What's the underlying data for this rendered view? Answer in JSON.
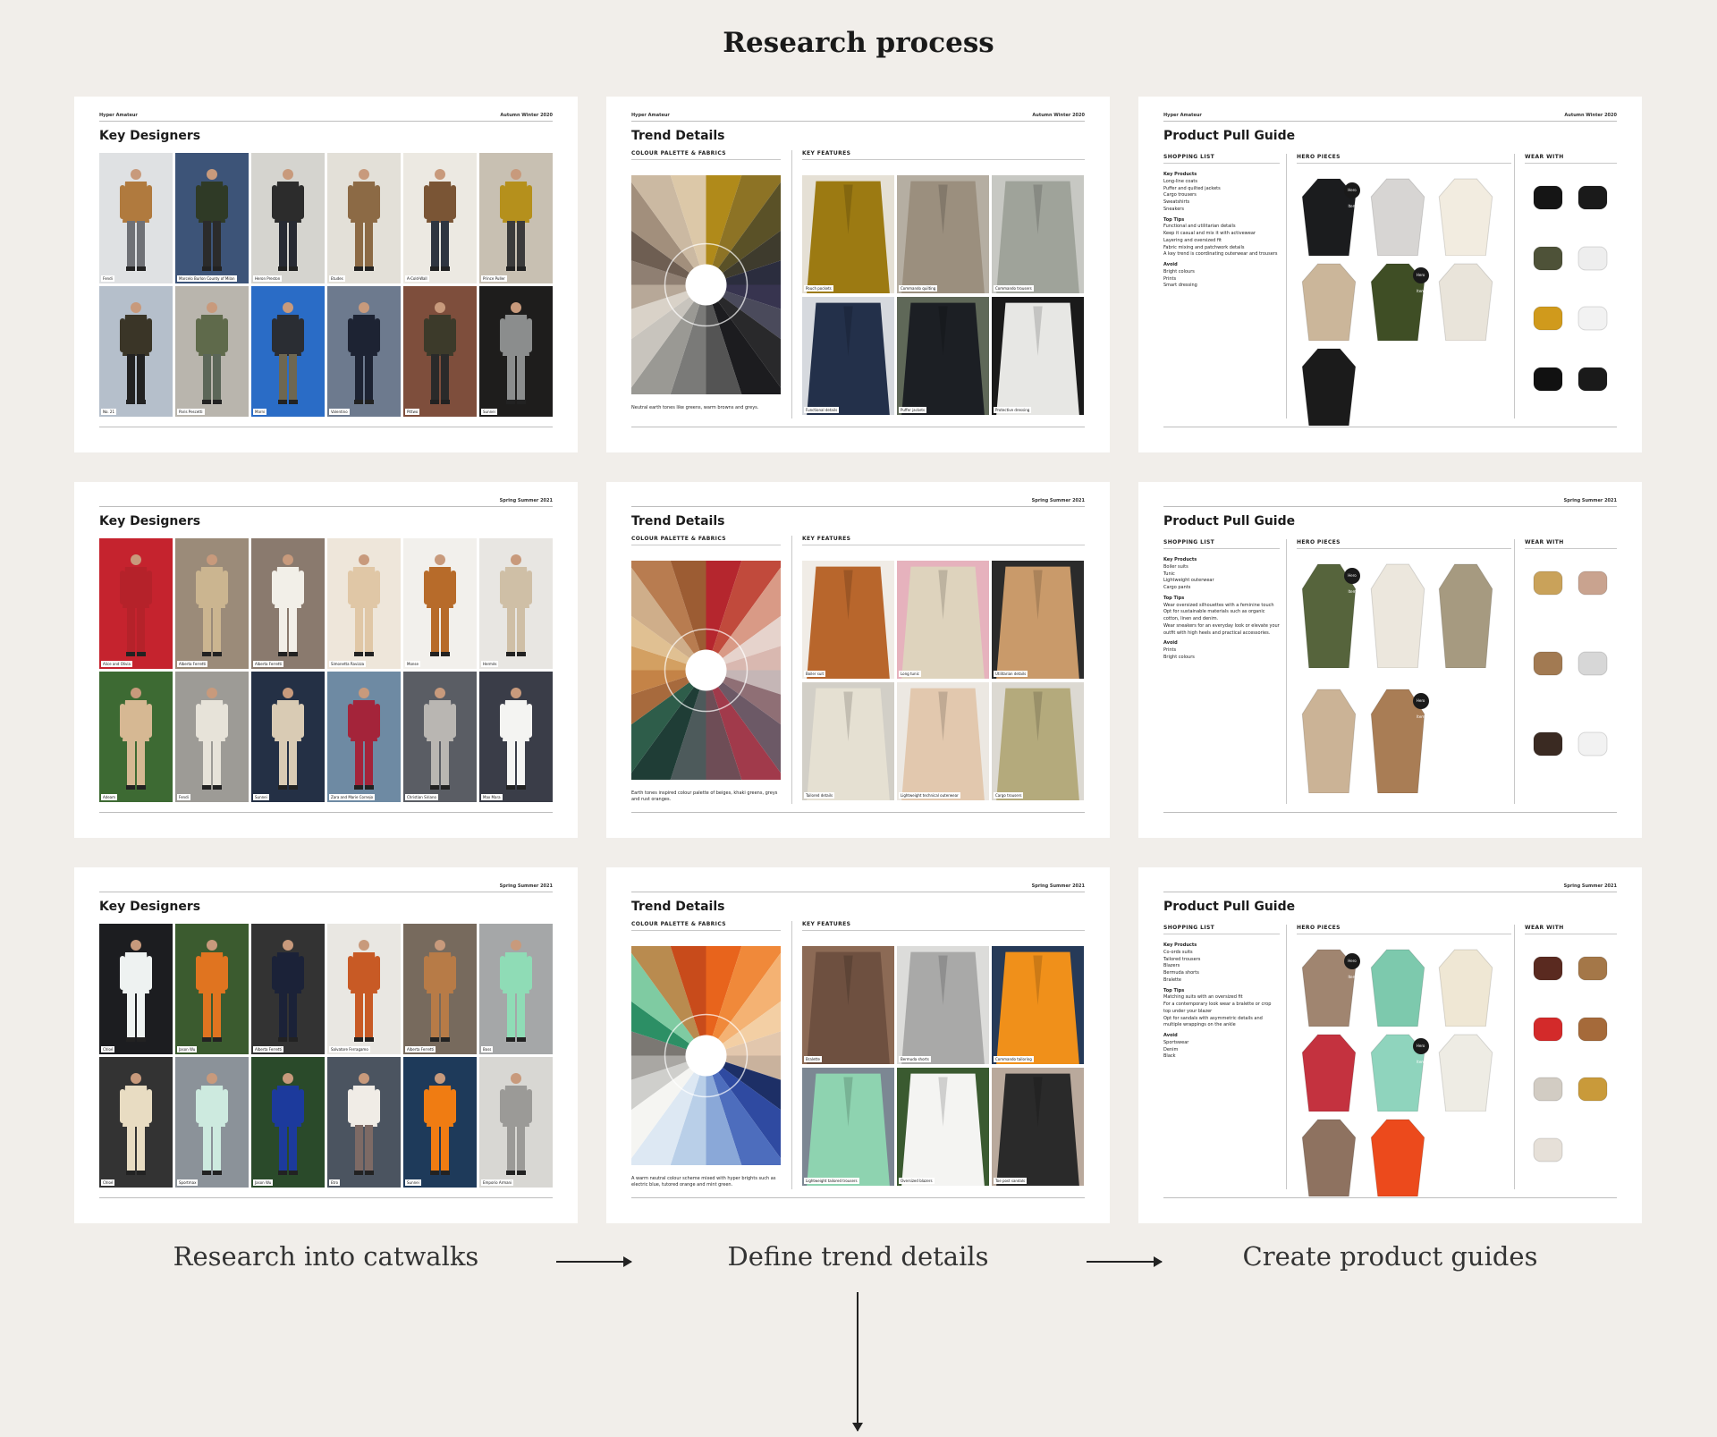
{
  "page_title": "Research process",
  "steps": [
    {
      "label": "Research into catwalks"
    },
    {
      "label": "Define trend details"
    },
    {
      "label": "Create product guides"
    }
  ],
  "rows": [
    {
      "season": "Autumn Winter 2020",
      "brand": "Hyper Amateur",
      "designers": {
        "title": "Key Designers",
        "looks": [
          {
            "caption": "Fendi",
            "bg": "#dfe1e3",
            "main": "#b07a3e",
            "leg": "#6f7176"
          },
          {
            "caption": "Marcelo Burlon County of Milan",
            "bg": "#3d5478",
            "main": "#2f3a26",
            "leg": "#2b2b2b"
          },
          {
            "caption": "Heron Preston",
            "bg": "#d5d4cf",
            "main": "#2c2c2c",
            "leg": "#272a33"
          },
          {
            "caption": "Etudes",
            "bg": "#e3e0d8",
            "main": "#8c6a45",
            "leg": "#8c6a45"
          },
          {
            "caption": "A-Cold-Wall",
            "bg": "#ece9e2",
            "main": "#7a5535",
            "leg": "#2f3540"
          },
          {
            "caption": "Prince Puller",
            "bg": "#c8c0b2",
            "main": "#b5901c",
            "leg": "#3b3b3b"
          },
          {
            "caption": "No. 21",
            "bg": "#b5bfcb",
            "main": "#3a3527",
            "leg": "#222222"
          },
          {
            "caption": "Paris Pescetti",
            "bg": "#b9b5ad",
            "main": "#5f6a4b",
            "leg": "#5b6658"
          },
          {
            "caption": "Marni",
            "bg": "#2a6cc6",
            "main": "#2a2d33",
            "leg": "#6e6751"
          },
          {
            "caption": "Valentino",
            "bg": "#6d7a8e",
            "main": "#1d2333",
            "leg": "#1d2333"
          },
          {
            "caption": "Pittwo",
            "bg": "#7e4e3c",
            "main": "#3c3a2a",
            "leg": "#2a2a2a"
          },
          {
            "caption": "Sunnei",
            "bg": "#1e1d1c",
            "main": "#8b8d8d",
            "leg": "#8b8d8d"
          }
        ]
      },
      "trend": {
        "title": "Trend Details",
        "palette_label": "COLOUR PALETTE & FABRICS",
        "features_label": "KEY FEATURES",
        "note": "Neutral earth tones like greens, warm browns and greys.",
        "colors": [
          "#b08a1a",
          "#8d7325",
          "#5a5127",
          "#3e3b2d",
          "#2b2d3e",
          "#37344f",
          "#4a4a5b",
          "#29292b",
          "#1c1c1f",
          "#545454",
          "#7a7a78",
          "#9a9994",
          "#c8c4bd",
          "#d9d2c8",
          "#b7a898",
          "#8f7f72",
          "#6e5e52",
          "#a28f7c",
          "#cbb9a2",
          "#dcc8a8"
        ],
        "photos": [
          {
            "caption": "Pouch pockets",
            "color": "#9c7a12",
            "bg": "#e5e0d5"
          },
          {
            "caption": "Commando quilting",
            "color": "#9b8f7e",
            "bg": "#b5aea2"
          },
          {
            "caption": "Commando trousers",
            "color": "#9fa39a",
            "bg": "#c7c8c3"
          },
          {
            "caption": "Functional details",
            "color": "#23304a",
            "bg": "#d6d9de"
          },
          {
            "caption": "Puffer jackets",
            "color": "#1c1f24",
            "bg": "#5f6858"
          },
          {
            "caption": "Protective dressing",
            "color": "#e7e7e4",
            "bg": "#1a1a1a"
          }
        ]
      },
      "product": {
        "title": "Product Pull Guide",
        "shop_label": "SHOPPING LIST",
        "hero_label": "HERO PIECES",
        "wear_label": "WEAR WITH",
        "key_products_label": "Key Products",
        "key_products": [
          "Long-line coats",
          "Puffer and quilted jackets",
          "Cargo trousers",
          "Sweatshirts",
          "Sneakers"
        ],
        "tips_label": "Top Tips",
        "tips": [
          "Functional and utilitarian details",
          "Keep it casual and mix it with activewear",
          "Layering and oversized fit",
          "Fabric mixing and patchwork details",
          "A key trend is coordinating outerwear and trousers"
        ],
        "avoid_label": "Avoid",
        "avoid": [
          "Bright colours",
          "Prints",
          "Smart dressing"
        ],
        "badge": "Hero Item",
        "hero": [
          "#1b1c1e",
          "#d7d5d3",
          "#f2ece0",
          "#cbb69a",
          "#3f4e25",
          "#e9e4da",
          "#1b1b1b"
        ],
        "wear": [
          "#151515",
          "#1a1a1a",
          "#4e5238",
          "#eeeeee",
          "#d09a1c",
          "#f2f2f2",
          "#111111",
          "#1a1a1a"
        ]
      }
    },
    {
      "season": "Spring Summer 2021",
      "brand": "",
      "designers": {
        "title": "Key Designers",
        "looks": [
          {
            "caption": "Alice and Olivia",
            "bg": "#c5232e",
            "main": "#b5222a",
            "leg": "#b5222a"
          },
          {
            "caption": "Alberta Ferretti",
            "bg": "#9b8b79",
            "main": "#cbb590",
            "leg": "#cbb590"
          },
          {
            "caption": "Alberta Ferretti",
            "bg": "#8a7a6e",
            "main": "#f2efe8",
            "leg": "#f2efe8"
          },
          {
            "caption": "Simonetta Ravizza",
            "bg": "#eee6da",
            "main": "#e0c7a6",
            "leg": "#e0c7a6"
          },
          {
            "caption": "Monse",
            "bg": "#f2f0ec",
            "main": "#b76b2a",
            "leg": "#b76b2a"
          },
          {
            "caption": "Hermès",
            "bg": "#e8e6e2",
            "main": "#cfbfa6",
            "leg": "#cfbfa6"
          },
          {
            "caption": "Adeam",
            "bg": "#3d6a33",
            "main": "#d6b893",
            "leg": "#d6b893"
          },
          {
            "caption": "Fendi",
            "bg": "#9d9b96",
            "main": "#e7e3d9",
            "leg": "#e7e3d9"
          },
          {
            "caption": "Sunnei",
            "bg": "#243045",
            "main": "#d9cbb4",
            "leg": "#d9cbb4"
          },
          {
            "caption": "Zara and Marie Cornejo",
            "bg": "#6e8aa3",
            "main": "#a4243a",
            "leg": "#a4243a"
          },
          {
            "caption": "Christian Siriano",
            "bg": "#5a5d64",
            "main": "#b9b6b2",
            "leg": "#b9b6b2"
          },
          {
            "caption": "Max Mara",
            "bg": "#3a3d48",
            "main": "#f4f4f2",
            "leg": "#f4f4f2"
          }
        ]
      },
      "trend": {
        "title": "Trend Details",
        "palette_label": "COLOUR PALETTE & FABRICS",
        "features_label": "KEY FEATURES",
        "note": "Earth tones inspired colour palette of beiges, khaki greens, greys and rust oranges.",
        "colors": [
          "#b5262e",
          "#c14a3c",
          "#d99a86",
          "#e6d3cc",
          "#d9b8b0",
          "#c5b6b6",
          "#8f6f75",
          "#6c5966",
          "#a13a4b",
          "#6e4d56",
          "#4d5a5b",
          "#1f3d36",
          "#2e5d4a",
          "#a76a3d",
          "#c48347",
          "#d3a062",
          "#e0c092",
          "#cfae8a",
          "#b87c50",
          "#9c5c33"
        ],
        "photos": [
          {
            "caption": "Boiler suit",
            "color": "#b8662c",
            "bg": "#f0ece6"
          },
          {
            "caption": "Long tunic",
            "color": "#ded3bd",
            "bg": "#e6b2bd"
          },
          {
            "caption": "Utilitarian details",
            "color": "#c99a6a",
            "bg": "#2b2b2b"
          },
          {
            "caption": "Tailored details",
            "color": "#e5e0d2",
            "bg": "#d2cfc7"
          },
          {
            "caption": "Lightweight technical outerwear",
            "color": "#e2c8ae",
            "bg": "#ece8e2"
          },
          {
            "caption": "Cargo trousers",
            "color": "#b4aa7c",
            "bg": "#dcd9d2"
          }
        ]
      },
      "product": {
        "title": "Product Pull Guide",
        "shop_label": "SHOPPING LIST",
        "hero_label": "HERO PIECES",
        "wear_label": "WEAR WITH",
        "key_products_label": "Key Products",
        "key_products": [
          "Boiler suits",
          "Tunic",
          "Lightweight outerwear",
          "Cargo pants"
        ],
        "tips_label": "Top Tips",
        "tips": [
          "Wear oversized silhouettes with a feminine touch",
          "Opt for sustainable materials such as organic cotton, linen and denim.",
          "Wear sneakers for an everyday look or elevate your outfit with high heels and practical accessories."
        ],
        "avoid_label": "Avoid",
        "avoid": [
          "Prints",
          "Bright colours"
        ],
        "badge": "Hero Item",
        "hero": [
          "#56643c",
          "#ece7dd",
          "#a69a80",
          "#cbb396",
          "#a97d55"
        ],
        "wear": [
          "#c9a25a",
          "#c9a38f",
          "#a27a52",
          "#d7d7d7",
          "#3a2a22",
          "#f2f2f2"
        ]
      }
    },
    {
      "season": "Spring Summer 2021",
      "brand": "",
      "designers": {
        "title": "Key Designers",
        "looks": [
          {
            "caption": "Chloé",
            "bg": "#1c1d20",
            "main": "#eef2f1",
            "leg": "#eef2f1"
          },
          {
            "caption": "Jason Wu",
            "bg": "#3b5b2f",
            "main": "#e07420",
            "leg": "#e07420"
          },
          {
            "caption": "Alberta Ferretti",
            "bg": "#333333",
            "main": "#1b2238",
            "leg": "#1b2238"
          },
          {
            "caption": "Salvatore Ferragamo",
            "bg": "#e9e7e2",
            "main": "#c85a25",
            "leg": "#c85a25"
          },
          {
            "caption": "Alberta Ferretti",
            "bg": "#776a5d",
            "main": "#b77b47",
            "leg": "#b77b47"
          },
          {
            "caption": "Boss",
            "bg": "#a5a7a8",
            "main": "#8fdcb6",
            "leg": "#8fdcb6"
          },
          {
            "caption": "Chloé",
            "bg": "#333333",
            "main": "#e8dcc2",
            "leg": "#e8dcc2"
          },
          {
            "caption": "Sportmax",
            "bg": "#8b9299",
            "main": "#cdeadf",
            "leg": "#cdeadf"
          },
          {
            "caption": "Jason Wu",
            "bg": "#2a4a2a",
            "main": "#1c3a9c",
            "leg": "#1c3a9c"
          },
          {
            "caption": "Etro",
            "bg": "#4b5460",
            "main": "#f0ece6",
            "leg": "#7d6a65"
          },
          {
            "caption": "Sunnei",
            "bg": "#1e3a5a",
            "main": "#f07c12",
            "leg": "#f07c12"
          },
          {
            "caption": "Emporio Armani",
            "bg": "#d8d7d3",
            "main": "#9b9a97",
            "leg": "#9b9a97"
          }
        ]
      },
      "trend": {
        "title": "Trend Details",
        "palette_label": "COLOUR PALETTE & FABRICS",
        "features_label": "KEY FEATURES",
        "note": "A warm neutral colour scheme mixed with hyper brights such as electric blue, tutored orange and mint green.",
        "colors": [
          "#e8641c",
          "#f0893a",
          "#f4b273",
          "#f3cfa4",
          "#e2c7ad",
          "#c9b29d",
          "#1d2f66",
          "#2f4aa1",
          "#4d6dbd",
          "#8aa8d8",
          "#b9cfe8",
          "#dde8f3",
          "#f5f5f2",
          "#cfcfcc",
          "#a9a7a3",
          "#7b7873",
          "#2c8f65",
          "#7fcba2",
          "#b98b4f",
          "#c84b1b"
        ],
        "photos": [
          {
            "caption": "Bralette",
            "color": "#6e5040",
            "bg": "#8c6a55"
          },
          {
            "caption": "Bermuda shorts",
            "color": "#a9a9a8",
            "bg": "#dcdcda"
          },
          {
            "caption": "Commando tailoring",
            "color": "#f0901a",
            "bg": "#263a58"
          },
          {
            "caption": "Lightweight tailored trousers",
            "color": "#8ed3b0",
            "bg": "#7c8793"
          },
          {
            "caption": "Oversized blazers",
            "color": "#f4f4f2",
            "bg": "#3a5a30"
          },
          {
            "caption": "Toe post sandals",
            "color": "#2a2a2a",
            "bg": "#b9a99c"
          }
        ]
      },
      "product": {
        "title": "Product Pull Guide",
        "shop_label": "SHOPPING LIST",
        "hero_label": "HERO PIECES",
        "wear_label": "WEAR WITH",
        "key_products_label": "Key Products",
        "key_products": [
          "Co-ords suits",
          "Tailored trousers",
          "Blazers",
          "Bermuda shorts",
          "Bralette"
        ],
        "tips_label": "Top Tips",
        "tips": [
          "Matching suits with an oversized fit",
          "For a contemporary look wear a bralette or crop top under your blazer",
          "Opt for sandals with asymmetric details and multiple wrappings on the ankle"
        ],
        "avoid_label": "Avoid",
        "avoid": [
          "Sportswear",
          "Denim",
          "Black"
        ],
        "badge": "Hero Item",
        "hero": [
          "#a08570",
          "#7dc9ad",
          "#efe7d4",
          "#c4323f",
          "#8fd4bd",
          "#eeece4",
          "#8e7260",
          "#ec4a1c"
        ],
        "wear": [
          "#5a2a20",
          "#a47748",
          "#d32a2a",
          "#a56a3a",
          "#d2ccc3",
          "#c99a3a",
          "#e6e0d8"
        ]
      }
    }
  ]
}
